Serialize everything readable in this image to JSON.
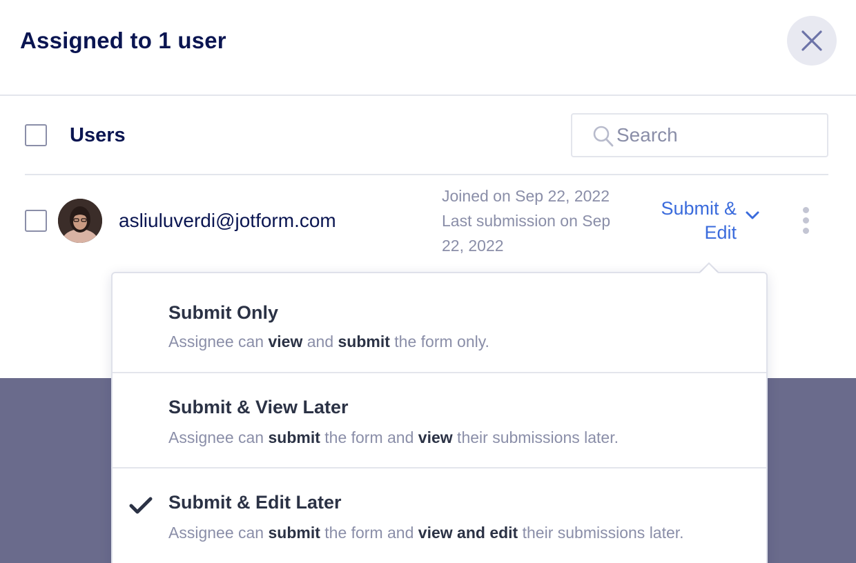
{
  "modal": {
    "title": "Assigned to 1 user"
  },
  "list_header": {
    "label": "Users",
    "search_placeholder": "Search"
  },
  "users": [
    {
      "email": "asliuluverdi@jotform.com",
      "meta_line_1": "Joined on Sep 22, 2022",
      "meta_line_2": "Last submission on Sep 22, 2022",
      "permission": "Submit & Edit"
    }
  ],
  "permission_options": [
    {
      "title": "Submit Only",
      "desc_parts": [
        "Assignee can ",
        "view",
        " and ",
        "submit",
        " the form only."
      ],
      "selected": false
    },
    {
      "title": "Submit & View Later",
      "desc_parts": [
        "Assignee can ",
        "submit",
        " the form and ",
        "view",
        " their submissions later."
      ],
      "selected": false
    },
    {
      "title": "Submit & Edit Later",
      "desc_parts": [
        "Assignee can ",
        "submit",
        " the form and ",
        "view and edit",
        " their submissions later."
      ],
      "selected": true
    }
  ],
  "icons": {
    "close": "close-icon",
    "search": "search-icon",
    "chevron": "chevron-down-icon",
    "more": "more-vertical-icon",
    "check": "check-icon"
  },
  "colors": {
    "title": "#0a1551",
    "accent": "#3a6bdc",
    "muted": "#8a8ea8",
    "overlay": "#6a6b8c"
  }
}
